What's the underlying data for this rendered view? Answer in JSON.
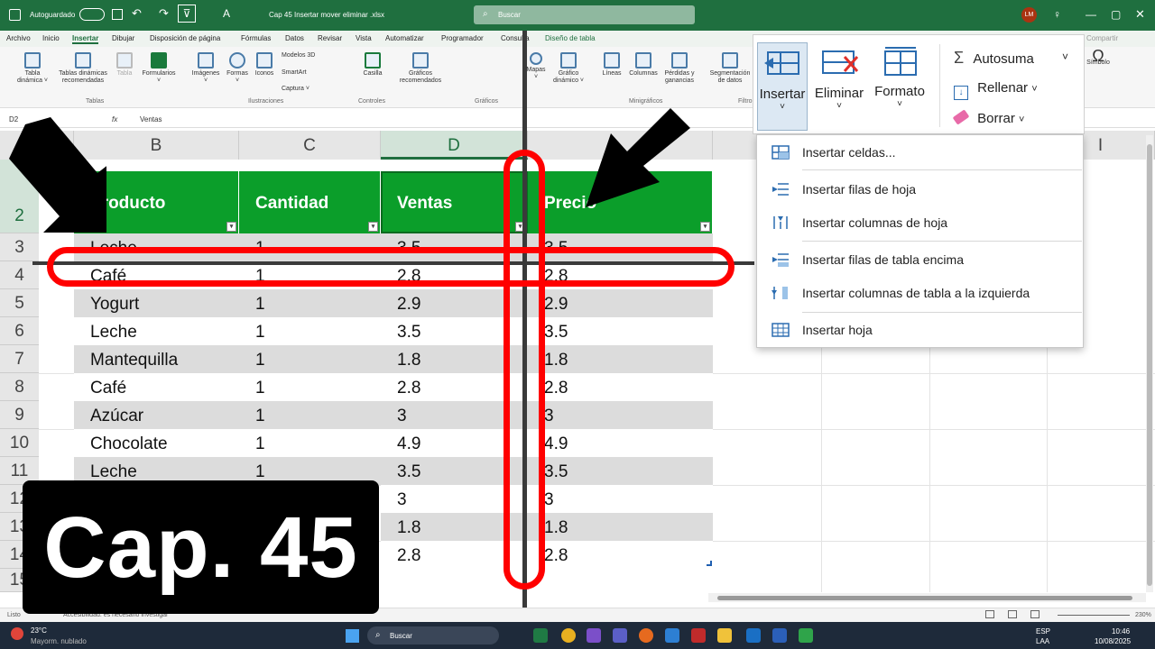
{
  "titlebar": {
    "autosave": "Autoguardado",
    "doc_name": "Cap 45 Insertar mover eliminar .xlsx",
    "search": "Buscar",
    "user_initials": "LM"
  },
  "menu": {
    "items": [
      "Archivo",
      "Inicio",
      "Insertar",
      "Dibujar",
      "Disposición de página",
      "Fórmulas",
      "Datos",
      "Revisar",
      "Vista",
      "Automatizar",
      "Programador",
      "Consulta",
      "Diseño de tabla"
    ],
    "right": "Compartir"
  },
  "ribbon": {
    "items": [
      {
        "l1": "Tabla",
        "l2": "dinámica ˅"
      },
      {
        "l1": "Tablas dinámicas",
        "l2": "recomendadas"
      },
      {
        "l1": "Tabla",
        "l2": ""
      },
      {
        "l1": "Formularios",
        "l2": "˅"
      },
      {
        "l1": "Imágenes",
        "l2": "˅"
      },
      {
        "l1": "Formas",
        "l2": "˅"
      },
      {
        "l1": "Iconos",
        "l2": ""
      },
      {
        "l1": "Casilla",
        "l2": ""
      },
      {
        "l1": "Gráficos",
        "l2": "recomendados"
      },
      {
        "l1": "Mapas",
        "l2": "˅"
      },
      {
        "l1": "Gráfico",
        "l2": "dinámico ˅"
      },
      {
        "l1": "Líneas",
        "l2": ""
      },
      {
        "l1": "Columnas",
        "l2": ""
      },
      {
        "l1": "Pérdidas y",
        "l2": "ganancias"
      },
      {
        "l1": "Segmentación",
        "l2": "de datos"
      },
      {
        "l1": "Símbolo",
        "l2": ""
      }
    ],
    "small": [
      "Modelos 3D",
      "SmartArt",
      "Captura ˅"
    ],
    "groups": [
      "Tablas",
      "Ilustraciones",
      "Controles",
      "Gráficos",
      "Minigráficos",
      "Filtro"
    ]
  },
  "formula": {
    "namebox": "D2",
    "fx": "fx",
    "value": "Ventas"
  },
  "columns": [
    "B",
    "C",
    "D",
    "I"
  ],
  "rows": [
    "2",
    "3",
    "4",
    "5",
    "6",
    "7",
    "8",
    "9",
    "10",
    "11",
    "12",
    "13",
    "14",
    "15"
  ],
  "table": {
    "headers": [
      "Producto",
      "Cantidad",
      "Ventas",
      "Precio"
    ],
    "rows": [
      [
        "Leche",
        "1",
        "3.5",
        "3.5"
      ],
      [
        "Café",
        "1",
        "2.8",
        "2.8"
      ],
      [
        "Yogurt",
        "1",
        "2.9",
        "2.9"
      ],
      [
        "Leche",
        "1",
        "3.5",
        "3.5"
      ],
      [
        "Mantequilla",
        "1",
        "1.8",
        "1.8"
      ],
      [
        "Café",
        "1",
        "2.8",
        "2.8"
      ],
      [
        "Azúcar",
        "1",
        "3",
        "3"
      ],
      [
        "Chocolate",
        "1",
        "4.9",
        "4.9"
      ],
      [
        "Leche",
        "1",
        "3.5",
        "3.5"
      ],
      [
        "",
        "",
        "3",
        "3"
      ],
      [
        "",
        "",
        "1.8",
        "1.8"
      ],
      [
        "",
        "",
        "2.8",
        "2.8"
      ]
    ]
  },
  "cells_group": {
    "insert": "Insertar",
    "delete": "Eliminar",
    "format": "Formato",
    "autosum": "Autosuma",
    "fill": "Rellenar",
    "clear": "Borrar"
  },
  "insert_menu": [
    "Insertar celdas...",
    "Insertar filas de hoja",
    "Insertar columnas de hoja",
    "Insertar filas de tabla encima",
    "Insertar columnas de tabla a la izquierda",
    "Insertar hoja"
  ],
  "status": {
    "ready": "Listo",
    "accessibility": "Accesibilidad: es necesario investigar",
    "zoom": "230%"
  },
  "taskbar": {
    "temp": "23°C",
    "weather": "Mayorm. nublado",
    "search": "Buscar",
    "lang1": "ESP",
    "lang2": "LAA",
    "time": "10:46",
    "date": "10/08/2025"
  },
  "overlay": {
    "caption": "Cap. 45"
  },
  "colors": {
    "excel_green": "#1f6f3f",
    "table_header": "#0b9e2a",
    "highlight": "#ff0000"
  }
}
